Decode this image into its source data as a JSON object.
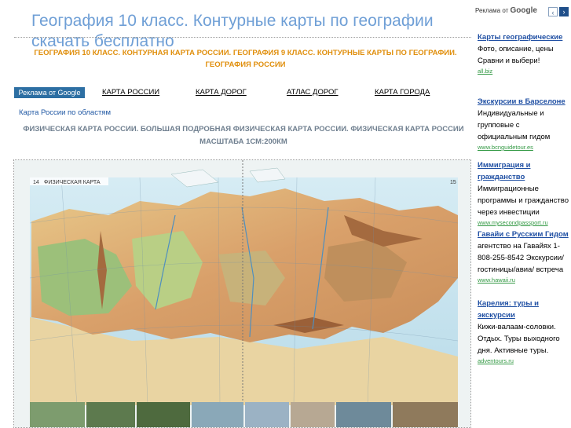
{
  "header": {
    "title": "География 10 класс. Контурные карты по географии скачать бесплатно",
    "subtitle": "ГЕОГРАФИЯ 10 КЛАСС. КОНТУРНАЯ КАРТА РОССИИ. ГЕОГРАФИЯ 9 КЛАСС. КОНТУРНЫЕ КАРТЫ ПО ГЕОГРАФИИ. ГЕОГРАФИЯ РОССИИ"
  },
  "nav": {
    "ads_label": "Реклама от Google",
    "links": [
      "КАРТА РОССИИ",
      "КАРТА ДОРОГ",
      "АТЛАС ДОРОГ",
      "КАРТА ГОРОДА"
    ]
  },
  "breadcrumb": "Карта России по областям",
  "map": {
    "heading": "ФИЗИЧЕСКАЯ КАРТА РОССИИ. БОЛЬШАЯ ПОДРОБНАЯ ФИЗИЧЕСКАЯ КАРТА РОССИИ. ФИЗИЧЕСКАЯ КАРТА РОССИИ МАСШТАБА 1СМ:200КМ",
    "page_left": "14",
    "page_label": "ФИЗИЧЕСКАЯ КАРТА",
    "page_right": "15"
  },
  "sidebar": {
    "ads_by_prefix": "Реклама от",
    "ads_by_brand": "Google",
    "prev": "‹",
    "next": "›",
    "ads": [
      {
        "title": "Карты географические",
        "desc": "Фото, описание, цены Сравни и выбери!",
        "url": "all.biz"
      },
      {
        "title": "Экскурсии в Барселоне",
        "desc": "Индивидуальные и групповые с официальным гидом",
        "url": "www.bcnguidetour.es"
      },
      {
        "title": "Иммиграция и гражданство",
        "desc": "Иммиграционные программы и гражданство через инвестиции",
        "url": "www.mysecondpassport.ru"
      },
      {
        "title": "Гавайи с Русским Гидом",
        "desc": "агентство на Гавайях 1-808-255-8542 Экскурсии/ гостиницы/авиа/ встреча",
        "url": "www.hawaii.ru"
      },
      {
        "title": "Карелия: туры и экскурсии",
        "desc": "Кижи-валаам-соловки. Отдых. Туры выходного дня. Активные туры.",
        "url": "adventours.ru"
      }
    ]
  },
  "colors": {
    "title_blue": "#6f9fd6",
    "orange": "#e08f0d",
    "link_blue": "#1f4fa3",
    "url_green": "#339944",
    "ads_badge": "#2d6fa3"
  }
}
